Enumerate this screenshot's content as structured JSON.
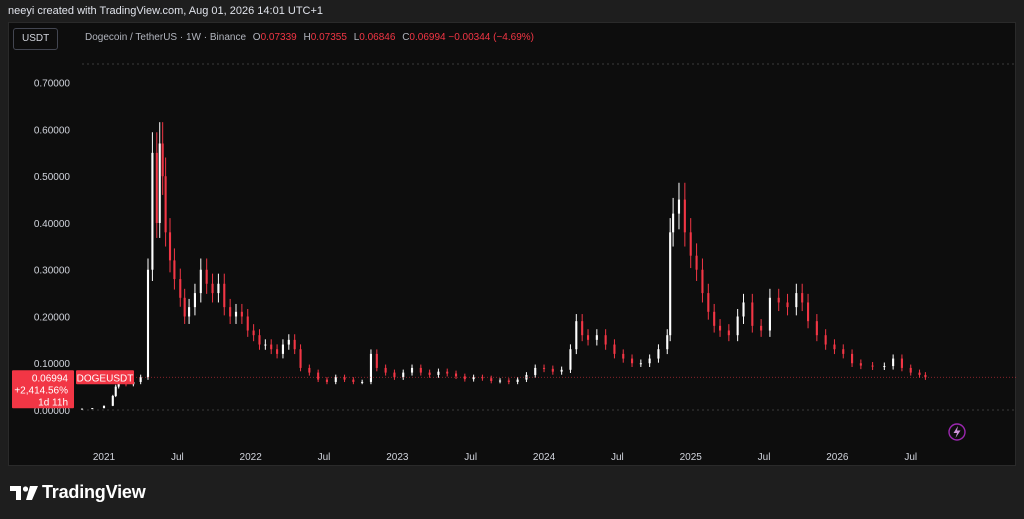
{
  "header": {
    "title": "neeyi created with TradingView.com, Aug 01, 2026 14:01 UTC+1"
  },
  "toolbar": {
    "currency": "USDT"
  },
  "legend": {
    "name": "Dogecoin / TetherUS · 1W · Binance",
    "o_key": "O",
    "o": "0.07339",
    "h_key": "H",
    "h": "0.07355",
    "l_key": "L",
    "l": "0.06846",
    "c_key": "C",
    "c": "0.06994",
    "change": "−0.00344 (−4.69%)"
  },
  "price_label": {
    "price": "0.06994",
    "symbol": "DOGEUSDT",
    "change_pct": "+2,414.56%",
    "countdown": "1d 11h"
  },
  "brand": {
    "name": "TradingView"
  },
  "colors": {
    "up": "#ffffff",
    "down": "#f23645",
    "background": "#0d0d0d",
    "accent": "#f23645"
  },
  "chart_data": {
    "type": "candlestick",
    "title": "Dogecoin / TetherUS · 1W · Binance",
    "ylim": [
      0,
      0.74
    ],
    "y_ticks": [
      "0.00000",
      "0.10000",
      "0.20000",
      "0.30000",
      "0.40000",
      "0.50000",
      "0.60000",
      "0.70000"
    ],
    "y_tick_values": [
      0,
      0.1,
      0.2,
      0.3,
      0.4,
      0.5,
      0.6,
      0.7
    ],
    "x_ticks": [
      {
        "label": "2021",
        "t": 2021.0
      },
      {
        "label": "Jul",
        "t": 2021.5
      },
      {
        "label": "2022",
        "t": 2022.0
      },
      {
        "label": "Jul",
        "t": 2022.5
      },
      {
        "label": "2023",
        "t": 2023.0
      },
      {
        "label": "Jul",
        "t": 2023.5
      },
      {
        "label": "2024",
        "t": 2024.0
      },
      {
        "label": "Jul",
        "t": 2024.5
      },
      {
        "label": "2025",
        "t": 2025.0
      },
      {
        "label": "Jul",
        "t": 2025.5
      },
      {
        "label": "2026",
        "t": 2026.0
      },
      {
        "label": "Jul",
        "t": 2026.5
      }
    ],
    "x_range": [
      2020.85,
      2026.87
    ],
    "last_close": 0.06994,
    "series": [
      {
        "values": [
          [
            2020.85,
            0.003
          ],
          [
            2020.92,
            0.004
          ],
          [
            2021.0,
            0.009
          ],
          [
            2021.06,
            0.03
          ],
          [
            2021.08,
            0.05
          ],
          [
            2021.1,
            0.06
          ],
          [
            2021.15,
            0.055
          ],
          [
            2021.2,
            0.06
          ],
          [
            2021.25,
            0.07
          ],
          [
            2021.3,
            0.3
          ],
          [
            2021.33,
            0.55
          ],
          [
            2021.36,
            0.4
          ],
          [
            2021.38,
            0.57
          ],
          [
            2021.4,
            0.5
          ],
          [
            2021.42,
            0.38
          ],
          [
            2021.45,
            0.32
          ],
          [
            2021.48,
            0.28
          ],
          [
            2021.52,
            0.24
          ],
          [
            2021.55,
            0.2
          ],
          [
            2021.58,
            0.22
          ],
          [
            2021.62,
            0.25
          ],
          [
            2021.66,
            0.3
          ],
          [
            2021.7,
            0.27
          ],
          [
            2021.74,
            0.25
          ],
          [
            2021.78,
            0.27
          ],
          [
            2021.82,
            0.22
          ],
          [
            2021.86,
            0.2
          ],
          [
            2021.9,
            0.21
          ],
          [
            2021.94,
            0.2
          ],
          [
            2021.98,
            0.17
          ],
          [
            2022.02,
            0.16
          ],
          [
            2022.06,
            0.14
          ],
          [
            2022.1,
            0.14
          ],
          [
            2022.14,
            0.13
          ],
          [
            2022.18,
            0.12
          ],
          [
            2022.22,
            0.14
          ],
          [
            2022.26,
            0.15
          ],
          [
            2022.3,
            0.13
          ],
          [
            2022.34,
            0.09
          ],
          [
            2022.4,
            0.08
          ],
          [
            2022.46,
            0.065
          ],
          [
            2022.52,
            0.06
          ],
          [
            2022.58,
            0.07
          ],
          [
            2022.64,
            0.065
          ],
          [
            2022.7,
            0.06
          ],
          [
            2022.76,
            0.06
          ],
          [
            2022.82,
            0.12
          ],
          [
            2022.86,
            0.09
          ],
          [
            2022.92,
            0.08
          ],
          [
            2022.98,
            0.07
          ],
          [
            2023.04,
            0.08
          ],
          [
            2023.1,
            0.09
          ],
          [
            2023.16,
            0.08
          ],
          [
            2023.22,
            0.075
          ],
          [
            2023.28,
            0.082
          ],
          [
            2023.34,
            0.078
          ],
          [
            2023.4,
            0.072
          ],
          [
            2023.46,
            0.066
          ],
          [
            2023.52,
            0.07
          ],
          [
            2023.58,
            0.068
          ],
          [
            2023.64,
            0.062
          ],
          [
            2023.7,
            0.063
          ],
          [
            2023.76,
            0.06
          ],
          [
            2023.82,
            0.065
          ],
          [
            2023.88,
            0.075
          ],
          [
            2023.94,
            0.09
          ],
          [
            2024.0,
            0.088
          ],
          [
            2024.06,
            0.082
          ],
          [
            2024.12,
            0.086
          ],
          [
            2024.18,
            0.13
          ],
          [
            2024.22,
            0.19
          ],
          [
            2024.26,
            0.16
          ],
          [
            2024.3,
            0.15
          ],
          [
            2024.36,
            0.16
          ],
          [
            2024.42,
            0.14
          ],
          [
            2024.48,
            0.12
          ],
          [
            2024.54,
            0.11
          ],
          [
            2024.6,
            0.1
          ],
          [
            2024.66,
            0.1
          ],
          [
            2024.72,
            0.11
          ],
          [
            2024.78,
            0.13
          ],
          [
            2024.84,
            0.16
          ],
          [
            2024.86,
            0.38
          ],
          [
            2024.88,
            0.42
          ],
          [
            2024.92,
            0.45
          ],
          [
            2024.96,
            0.38
          ],
          [
            2025.0,
            0.33
          ],
          [
            2025.04,
            0.3
          ],
          [
            2025.08,
            0.25
          ],
          [
            2025.12,
            0.21
          ],
          [
            2025.16,
            0.18
          ],
          [
            2025.2,
            0.17
          ],
          [
            2025.26,
            0.16
          ],
          [
            2025.32,
            0.2
          ],
          [
            2025.36,
            0.23
          ],
          [
            2025.42,
            0.18
          ],
          [
            2025.48,
            0.17
          ],
          [
            2025.54,
            0.24
          ],
          [
            2025.6,
            0.23
          ],
          [
            2025.66,
            0.22
          ],
          [
            2025.72,
            0.25
          ],
          [
            2025.76,
            0.23
          ],
          [
            2025.8,
            0.19
          ],
          [
            2025.86,
            0.16
          ],
          [
            2025.92,
            0.14
          ],
          [
            2025.98,
            0.13
          ],
          [
            2026.04,
            0.12
          ],
          [
            2026.1,
            0.1
          ],
          [
            2026.16,
            0.095
          ],
          [
            2026.24,
            0.093
          ],
          [
            2026.32,
            0.094
          ],
          [
            2026.38,
            0.11
          ],
          [
            2026.44,
            0.09
          ],
          [
            2026.5,
            0.08
          ],
          [
            2026.56,
            0.075
          ],
          [
            2026.6,
            0.07
          ]
        ]
      }
    ]
  }
}
